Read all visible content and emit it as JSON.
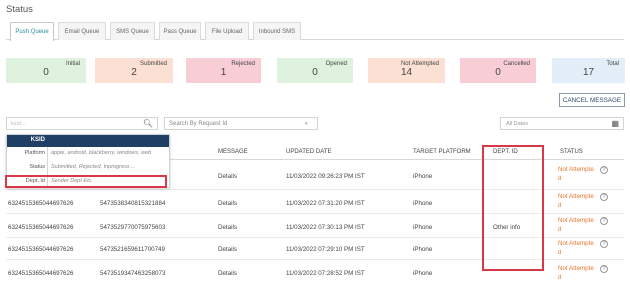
{
  "header": {
    "title": "Status"
  },
  "tabs": [
    {
      "label": "Push Queue",
      "active": true
    },
    {
      "label": "Email Queue",
      "active": false
    },
    {
      "label": "SMS Queue",
      "active": false
    },
    {
      "label": "Pass Queue",
      "active": false
    },
    {
      "label": "File Upload",
      "active": false
    },
    {
      "label": "Inbound SMS",
      "active": false
    }
  ],
  "stats": [
    {
      "label": "Initial",
      "value": "0",
      "bg": "#dff2df"
    },
    {
      "label": "Submitted",
      "value": "2",
      "bg": "#fbe0d3"
    },
    {
      "label": "Rejected",
      "value": "1",
      "bg": "#f9cdd6"
    },
    {
      "label": "Opened",
      "value": "0",
      "bg": "#dff2df"
    },
    {
      "label": "Not Attempted",
      "value": "14",
      "bg": "#fbe0d3"
    },
    {
      "label": "Cancelled",
      "value": "0",
      "bg": "#f9cdd6"
    },
    {
      "label": "Total",
      "value": "17",
      "bg": "#e3eef8"
    }
  ],
  "cancel_button": {
    "label": "CANCEL MESSAGE"
  },
  "filters": {
    "ksid_placeholder": "ksid...",
    "request_placeholder": "Search By Request Id",
    "date_placeholder": "All Dates"
  },
  "dropdown": {
    "header": "KSID",
    "rows": [
      {
        "key": "Platform",
        "value": "apple, android, blackberry, windows, web"
      },
      {
        "key": "Status",
        "value": "Submitted, Rejected, Inprogress ..."
      },
      {
        "key": "Dept. Id",
        "value": "Sender Dept Etc."
      }
    ]
  },
  "table": {
    "columns": [
      "MESSAGE",
      "UPDATED DATE",
      "TARGET PLATFORM",
      "DEPT. ID",
      "STATUS"
    ],
    "rows": [
      {
        "ksid": "",
        "request_id": "",
        "message": "Details",
        "date": "11/03/2022 09:26:23 PM IST",
        "platform": "iPhone",
        "dept": "",
        "status_1": "Not Attempte",
        "status_2": "d"
      },
      {
        "ksid": "6324515365044697626",
        "request_id": "5473538340815321884",
        "message": "Details",
        "date": "11/03/2022 07:31:20 PM IST",
        "platform": "iPhone",
        "dept": "",
        "status_1": "Not Attempte",
        "status_2": "d"
      },
      {
        "ksid": "6324515365044697626",
        "request_id": "5473529770075975603",
        "message": "Details",
        "date": "11/03/2022 07:30:13 PM IST",
        "platform": "iPhone",
        "dept": "Other info",
        "status_1": "Not Attempte",
        "status_2": "d"
      },
      {
        "ksid": "6324515365044697626",
        "request_id": "5473521659611700749",
        "message": "Details",
        "date": "11/03/2022 07:29:10 PM IST",
        "platform": "iPhone",
        "dept": "",
        "status_1": "Not Attempte",
        "status_2": "d"
      },
      {
        "ksid": "6324515365044697626",
        "request_id": "5473519347463258073",
        "message": "Details",
        "date": "11/03/2022 07:28:52 PM IST",
        "platform": "iPhone",
        "dept": "",
        "status_1": "Not Attempte",
        "status_2": "d"
      }
    ]
  },
  "colors": {
    "accent": "#2a8fa8",
    "status_orange": "#e8792f",
    "highlight_red": "#d93848",
    "dropdown_header": "#1f3f64"
  },
  "icons": {
    "search": "magnifier-icon",
    "calendar": "calendar-icon",
    "info": "info-circle-icon"
  }
}
